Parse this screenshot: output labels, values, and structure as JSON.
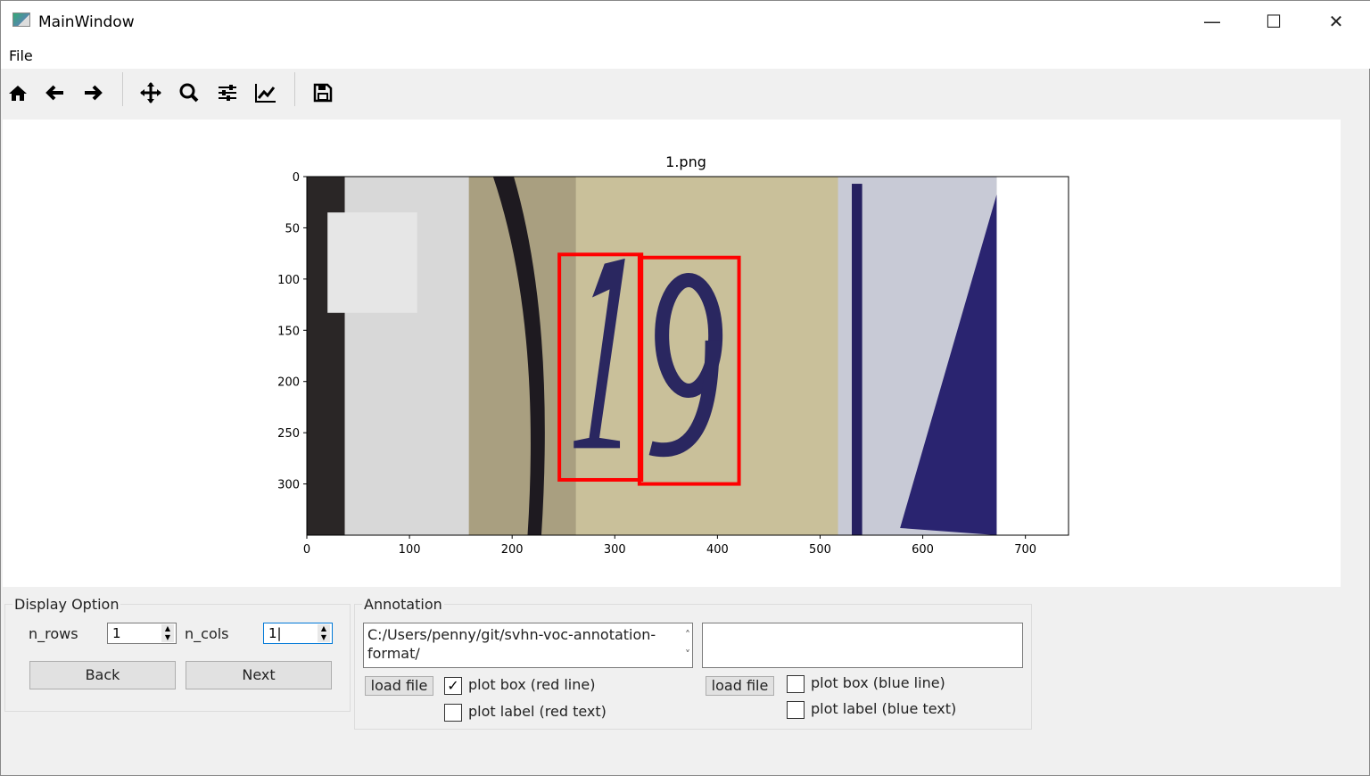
{
  "window": {
    "title": "MainWindow",
    "minimize": "—",
    "maximize": "☐",
    "close": "✕"
  },
  "menu": {
    "file": "File"
  },
  "toolbar": [
    "home-icon",
    "back-arrow-icon",
    "forward-arrow-icon",
    "pan-icon",
    "zoom-icon",
    "configure-subplots-icon",
    "edit-axis-icon",
    "save-icon"
  ],
  "chart_data": {
    "type": "image",
    "title": "1.png",
    "xlim": [
      0,
      742
    ],
    "ylim": [
      350,
      0
    ],
    "xticks": [
      "0",
      "100",
      "200",
      "300",
      "400",
      "500",
      "600",
      "700"
    ],
    "xtick_values": [
      0,
      100,
      200,
      300,
      400,
      500,
      600,
      700
    ],
    "yticks": [
      "0",
      "50",
      "100",
      "150",
      "200",
      "250",
      "300"
    ],
    "ytick_values": [
      0,
      50,
      100,
      150,
      200,
      250,
      300
    ],
    "image_size": [
      672,
      350
    ],
    "boxes": [
      {
        "x0": 246,
        "y0": 76,
        "x1": 326,
        "y1": 296,
        "color": "#ff0000"
      },
      {
        "x0": 324,
        "y0": 79,
        "x1": 421,
        "y1": 300,
        "color": "#ff0000"
      }
    ]
  },
  "display_option": {
    "title": "Display Option",
    "n_rows_label": "n_rows",
    "n_rows": "1",
    "n_cols_label": "n_cols",
    "n_cols": "1",
    "back": "Back",
    "next": "Next"
  },
  "annotation": {
    "title": "Annotation",
    "left_path": "C:/Users/penny/git/svhn-voc-annotation-format/",
    "right_path": "",
    "load_file": "load file",
    "plot_box_red": "plot box (red line)",
    "plot_label_red": "plot label (red text)",
    "plot_box_red_checked": true,
    "plot_label_red_checked": false,
    "load_file_2": "load file",
    "plot_box_blue": "plot box (blue line)",
    "plot_label_blue": "plot label (blue text)",
    "plot_box_blue_checked": false,
    "plot_label_blue_checked": false
  }
}
